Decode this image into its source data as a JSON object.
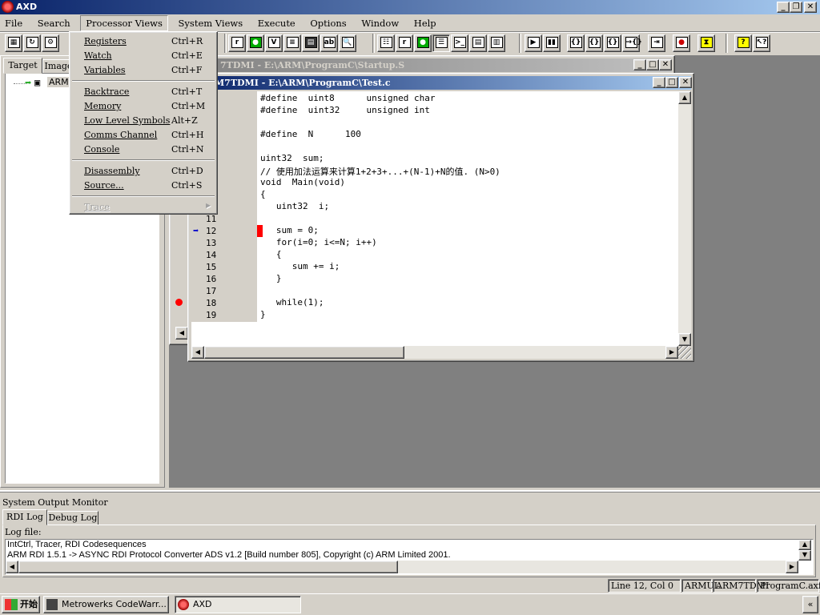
{
  "app": {
    "title": "AXD"
  },
  "menubar": {
    "items": [
      "File",
      "Search",
      "Processor Views",
      "System Views",
      "Execute",
      "Options",
      "Window",
      "Help"
    ]
  },
  "processor_views_menu": {
    "items": [
      {
        "label": "Registers",
        "shortcut": "Ctrl+R"
      },
      {
        "label": "Watch",
        "shortcut": "Ctrl+E"
      },
      {
        "label": "Variables",
        "shortcut": "Ctrl+F"
      },
      {
        "label": "Backtrace",
        "shortcut": "Ctrl+T"
      },
      {
        "label": "Memory",
        "shortcut": "Ctrl+M"
      },
      {
        "label": "Low Level Symbols",
        "shortcut": "Alt+Z"
      },
      {
        "label": "Comms Channel",
        "shortcut": "Ctrl+H"
      },
      {
        "label": "Console",
        "shortcut": "Ctrl+N"
      },
      {
        "label": "Disassembly",
        "shortcut": "Ctrl+D"
      },
      {
        "label": "Source...",
        "shortcut": "Ctrl+S"
      },
      {
        "label": "Trace",
        "shortcut": ""
      }
    ]
  },
  "left_panel": {
    "tabs": [
      "Target",
      "Image"
    ],
    "tree_item": "ARM"
  },
  "startup_window": {
    "title": "7TDMI - E:\\ARM\\ProgramC\\Startup.S"
  },
  "test_window": {
    "title": "M7TDMI - E:\\ARM\\ProgramC\\Test.c",
    "code": [
      {
        "n": "",
        "t": "#define  uint8      unsigned char"
      },
      {
        "n": "",
        "t": "#define  uint32     unsigned int"
      },
      {
        "n": "",
        "t": ""
      },
      {
        "n": "",
        "t": "#define  N      100"
      },
      {
        "n": "",
        "t": ""
      },
      {
        "n": "",
        "t": "uint32  sum;"
      },
      {
        "n": "",
        "t": "// 使用加法运算来计算1+2+3+...+(N-1)+N的值. (N>0)"
      },
      {
        "n": "",
        "t": "void  Main(void)"
      },
      {
        "n": "",
        "t": "{"
      },
      {
        "n": "",
        "t": "   uint32  i;"
      },
      {
        "n": "11",
        "t": ""
      },
      {
        "n": "12",
        "t": "   sum = 0;"
      },
      {
        "n": "13",
        "t": "   for(i=0; i<=N; i++)"
      },
      {
        "n": "14",
        "t": "   {"
      },
      {
        "n": "15",
        "t": "      sum += i;"
      },
      {
        "n": "16",
        "t": "   }"
      },
      {
        "n": "17",
        "t": ""
      },
      {
        "n": "18",
        "t": "   while(1);"
      },
      {
        "n": "19",
        "t": "}"
      }
    ],
    "current_line": "12",
    "breakpoint_line": "18"
  },
  "output_monitor": {
    "title": "System Output Monitor",
    "tabs": [
      "RDI Log",
      "Debug Log"
    ],
    "log_label": "Log file:",
    "lines": [
      "IntCtrl, Tracer, RDI Codesequences",
      "ARM RDI 1.5.1 -> ASYNC RDI Protocol Converter ADS v1.2 [Build number 805], Copyright (c) ARM Limited 2001."
    ]
  },
  "statusbar": {
    "position": "Line 12, Col 0",
    "mode": "ARMUL",
    "target": "ARM7TDMI",
    "image": "ProgramC.axf"
  },
  "taskbar": {
    "start": "开始",
    "tasks": [
      "Metrowerks CodeWarr...",
      "AXD"
    ]
  },
  "colors": {
    "titlebar": "#0a246a",
    "workspace": "#808080",
    "breakpoint": "#ff0000",
    "current_marker": "#ff0000"
  }
}
